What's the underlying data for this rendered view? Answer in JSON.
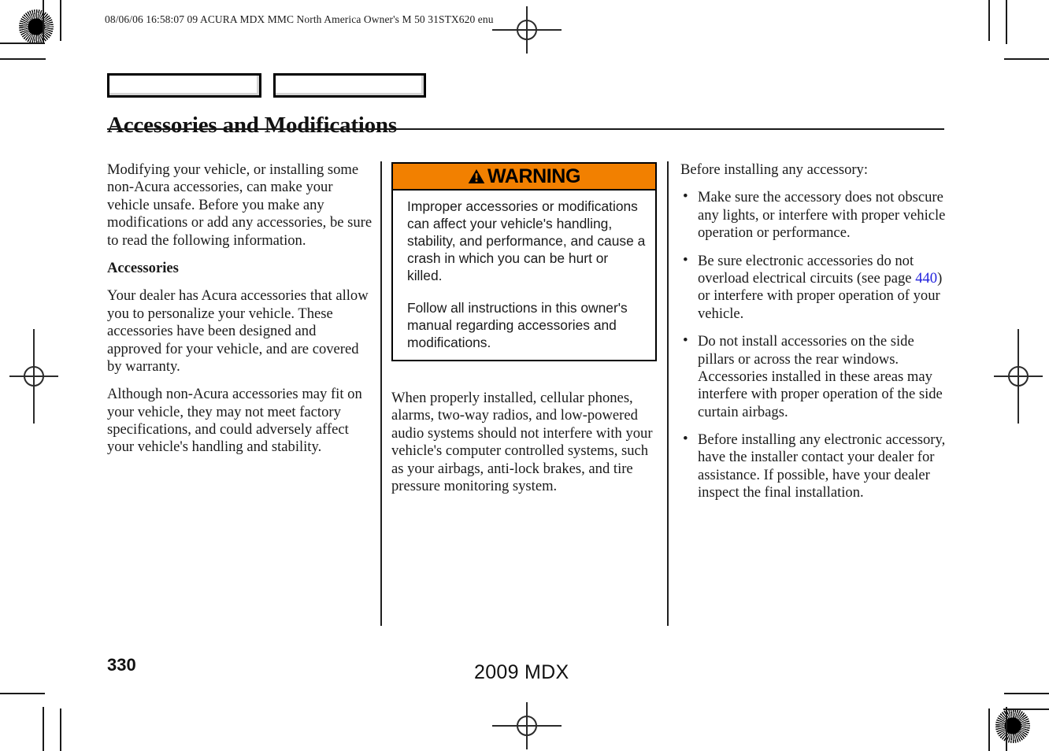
{
  "print_slug": "08/06/06 16:58:07   09 ACURA MDX MMC North America Owner's M 50 31STX620 enu",
  "header": {
    "section_title": "Accessories and Modifications",
    "tab_boxes": [
      "",
      ""
    ]
  },
  "column_one": {
    "intro": "Modifying your vehicle, or installing some non-Acura accessories, can make your vehicle unsafe. Before you make any modifications or add any accessories, be sure to read the following information.",
    "subhead": "Accessories",
    "paragraph_2": "Your dealer has Acura accessories that allow you to personalize your vehicle. These accessories have been designed and approved for your vehicle, and are covered by warranty.",
    "paragraph_3": "Although non-Acura accessories may fit on your vehicle, they may not meet factory specifications, and could adversely affect your vehicle's handling and stability."
  },
  "warning": {
    "label": "WARNING",
    "icon": "warning-triangle-icon",
    "banner_color": "#F28000",
    "paragraph_1": "Improper accessories or modifications can affect your vehicle's handling, stability, and performance, and cause a crash in which you can be hurt or killed.",
    "paragraph_2": "Follow all instructions in this owner's manual regarding accessories and modifications."
  },
  "column_two": {
    "after_warning": "When properly installed, cellular phones, alarms, two-way radios, and low-powered audio systems should not interfere with your vehicle's computer controlled systems, such as your airbags, anti-lock brakes, and tire pressure monitoring system."
  },
  "column_three": {
    "lead_in": "Before installing any accessory:",
    "bullets": [
      {
        "text_before": "Make sure the accessory does not obscure any lights, or interfere with proper vehicle operation or performance.",
        "xref": "",
        "text_after": ""
      },
      {
        "text_before": "Be sure electronic accessories do not overload electrical circuits (see page ",
        "xref": "440",
        "text_after": ") or interfere with proper operation of your vehicle."
      },
      {
        "text_before": "Do not install accessories on the side pillars or across the rear windows. Accessories installed in these areas may interfere with proper operation of the side curtain airbags.",
        "xref": "",
        "text_after": ""
      },
      {
        "text_before": "Before installing any electronic accessory, have the installer contact your dealer for assistance. If possible, have your dealer inspect the final installation.",
        "xref": "",
        "text_after": ""
      }
    ],
    "xref_color": "#2222DD"
  },
  "footer": {
    "page_number": "330",
    "model_line": "2009  MDX"
  }
}
